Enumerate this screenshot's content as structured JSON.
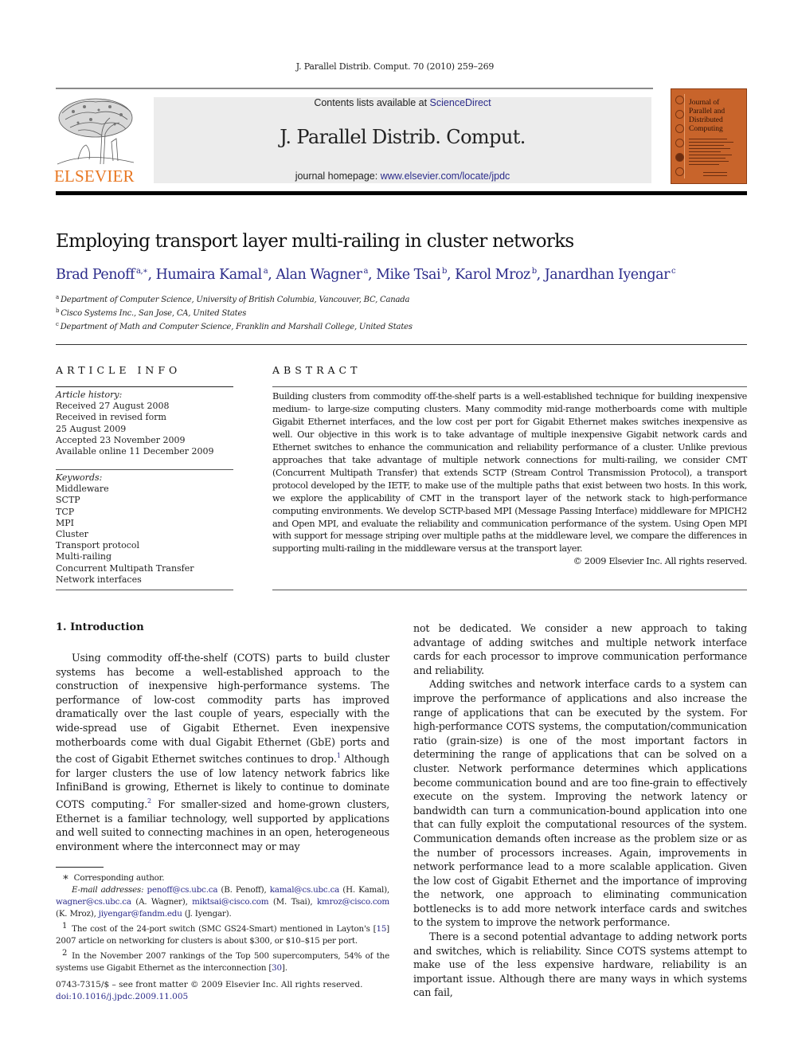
{
  "running_head": "J. Parallel Distrib. Comput. 70 (2010) 259–269",
  "publisher": {
    "logo_icon": "elsevier-tree-logo",
    "wordmark": "ELSEVIER",
    "brand_color": "#e87722"
  },
  "masthead": {
    "contents_prefix": "Contents lists available at ",
    "contents_link": "ScienceDirect",
    "journal_name": "J. Parallel Distrib. Comput.",
    "homepage_prefix": "journal homepage: ",
    "homepage_link": "www.elsevier.com/locate/jpdc",
    "background_color": "#ececec",
    "link_color": "#2b2b8a"
  },
  "cover": {
    "title_lines": [
      "Journal of",
      "Parallel and",
      "Distributed",
      "Computing"
    ],
    "color": "#c8642b"
  },
  "article": {
    "title": "Employing transport layer multi-railing in cluster networks",
    "authors": [
      {
        "name": "Brad Penoff",
        "sup": "a,∗"
      },
      {
        "name": "Humaira Kamal",
        "sup": "a"
      },
      {
        "name": "Alan Wagner",
        "sup": "a"
      },
      {
        "name": "Mike Tsai",
        "sup": "b"
      },
      {
        "name": "Karol Mroz",
        "sup": "b"
      },
      {
        "name": "Janardhan Iyengar",
        "sup": "c"
      }
    ],
    "affiliations": [
      {
        "mark": "a",
        "text": "Department of Computer Science, University of British Columbia, Vancouver, BC, Canada"
      },
      {
        "mark": "b",
        "text": "Cisco Systems Inc., San Jose, CA, United States"
      },
      {
        "mark": "c",
        "text": "Department of Math and Computer Science, Franklin and Marshall College, United States"
      }
    ]
  },
  "article_info": {
    "heading": "ARTICLE INFO",
    "history_label": "Article history:",
    "history": [
      "Received 27 August 2008",
      "Received in revised form",
      "25 August 2009",
      "Accepted 23 November 2009",
      "Available online 11 December 2009"
    ],
    "keywords_label": "Keywords:",
    "keywords": [
      "Middleware",
      "SCTP",
      "TCP",
      "MPI",
      "Cluster",
      "Transport protocol",
      "Multi-railing",
      "Concurrent Multipath Transfer",
      "Network interfaces"
    ]
  },
  "abstract": {
    "heading": "ABSTRACT",
    "text": "Building clusters from commodity off-the-shelf parts is a well-established technique for building inexpensive medium- to large-size computing clusters. Many commodity mid-range motherboards come with multiple Gigabit Ethernet interfaces, and the low cost per port for Gigabit Ethernet makes switches inexpensive as well. Our objective in this work is to take advantage of multiple inexpensive Gigabit network cards and Ethernet switches to enhance the communication and reliability performance of a cluster. Unlike previous approaches that take advantage of multiple network connections for multi-railing, we consider CMT (Concurrent Multipath Transfer) that extends SCTP (Stream Control Transmission Protocol), a transport protocol developed by the IETF, to make use of the multiple paths that exist between two hosts. In this work, we explore the applicability of CMT in the transport layer of the network stack to high-performance computing environments. We develop SCTP-based MPI (Message Passing Interface) middleware for MPICH2 and Open MPI, and evaluate the reliability and communication performance of the system. Using Open MPI with support for message striping over multiple paths at the middleware level, we compare the differences in supporting multi-railing in the middleware versus at the transport layer.",
    "copyright": "© 2009 Elsevier Inc. All rights reserved."
  },
  "introduction": {
    "heading": "1.  Introduction",
    "left_p1_a": "Using commodity off-the-shelf (COTS) parts to build cluster systems has become a well-established approach to the construction of inexpensive high-performance systems. The performance of low-cost commodity parts has improved dramatically over the last couple of years, especially with the wide-spread use of Gigabit Ethernet. Even inexpensive motherboards come with dual Gigabit Ethernet (GbE) ports and the cost of Gigabit Ethernet switches continues to drop.",
    "fn_ref_1": "1",
    "left_p1_b": " Although for larger clusters the use of low latency network fabrics like InfiniBand is growing, Ethernet is likely to continue to dominate COTS computing.",
    "fn_ref_2": "2",
    "left_p1_c": " For smaller-sized and home-grown clusters, Ethernet is a familiar technology, well supported by applications and well suited to connecting machines in an open, heterogeneous environment where the interconnect may or may",
    "right_p1": "not be dedicated. We consider a new approach to taking advantage of adding switches and multiple network interface cards for each processor to improve communication performance and reliability.",
    "right_p2": "Adding switches and network interface cards to a system can improve the performance of applications and also increase the range of applications that can be executed by the system. For high-performance COTS systems, the computation/communication ratio (grain-size) is one of the most important factors in determining the range of applications that can be solved on a cluster. Network performance determines which applications become communication bound and are too fine-grain to effectively execute on the system. Improving the network latency or bandwidth can turn a communication-bound application into one that can fully exploit the computational resources of the system. Communication demands often increase as the problem size or as the number of processors increases. Again, improvements in network performance lead to a more scalable application. Given the low cost of Gigabit Ethernet and the importance of improving the network, one approach to eliminating communication bottlenecks is to add more network interface cards and switches to the system to improve the network performance.",
    "right_p3": "There is a second potential advantage to adding network ports and switches, which is reliability. Since COTS systems attempt to make use of the less expensive hardware, reliability is an important issue. Although there are many ways in which systems can fail,"
  },
  "footnotes": {
    "corresponding_mark": "∗",
    "corresponding_text": "Corresponding author.",
    "email_label": "E-mail addresses:",
    "emails": [
      {
        "addr": "penoff@cs.ubc.ca",
        "who": " (B. Penoff), "
      },
      {
        "addr": "kamal@cs.ubc.ca",
        "who": " (H. Kamal), "
      },
      {
        "addr": "wagner@cs.ubc.ca",
        "who": " (A. Wagner), "
      },
      {
        "addr": "miktsai@cisco.com",
        "who": " (M. Tsai), "
      },
      {
        "addr": "kmroz@cisco.com",
        "who": " (K. Mroz), "
      },
      {
        "addr": "jiyengar@fandm.edu",
        "who": " (J. Iyengar)."
      }
    ],
    "fn1_mark": "1",
    "fn1_a": "The cost of the 24-port switch (SMC GS24-Smart) mentioned in Layton's [",
    "fn1_ref": "15",
    "fn1_b": "] 2007 article on networking for clusters is about $300, or $10–$15 per port.",
    "fn2_mark": "2",
    "fn2_a": "In the November 2007 rankings of the Top 500 supercomputers, 54% of the systems use Gigabit Ethernet as the interconnection [",
    "fn2_ref": "30",
    "fn2_b": "]."
  },
  "front_matter": {
    "issn_line": "0743-7315/$ – see front matter © 2009 Elsevier Inc. All rights reserved.",
    "doi": "doi:10.1016/j.jpdc.2009.11.005"
  }
}
